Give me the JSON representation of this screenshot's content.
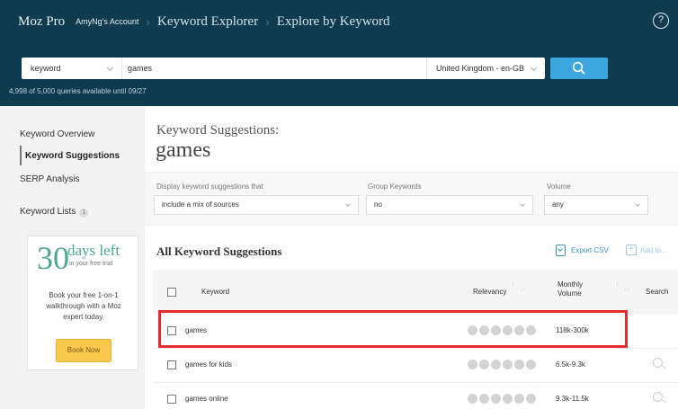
{
  "header": {
    "brand": "Moz Pro",
    "account": "AmyNg's Account",
    "breadcrumbs": [
      "Keyword Explorer",
      "Explore by Keyword"
    ],
    "help_glyph": "?"
  },
  "search": {
    "type_value": "keyword",
    "query_value": "games",
    "locale_value": "United Kingdom - en-GB",
    "quota_text": "4,998 of 5,000 queries available until 09/27"
  },
  "sidebar": {
    "items": [
      {
        "label": "Keyword Overview"
      },
      {
        "label": "Keyword Suggestions"
      },
      {
        "label": "SERP Analysis"
      },
      {
        "label": "Keyword Lists"
      }
    ],
    "lists_count": "1",
    "trial": {
      "days_number": "30",
      "days_label": "days left",
      "sub": "in your free trial",
      "text": "Book your free 1-on-1 walkthrough with a Moz expert today.",
      "button": "Book Now"
    }
  },
  "main": {
    "heading": "Keyword Suggestions:",
    "query": "games",
    "filters": {
      "display_label": "Display keyword suggestions that",
      "display_value": "include a mix of sources",
      "group_label": "Group Keywords",
      "group_value": "no",
      "volume_label": "Volume",
      "volume_value": "any"
    },
    "section_title": "All Keyword Suggestions",
    "export_label": "Export CSV",
    "addto_label": "Add to...",
    "table": {
      "headers": {
        "keyword": "Keyword",
        "relevancy": "Relevancy",
        "volume_line1": "Monthly",
        "volume_line2": "Volume",
        "search": "Search"
      },
      "rows": [
        {
          "keyword": "games",
          "volume": "118k-300k"
        },
        {
          "keyword": "games for kids",
          "volume": "6.5k-9.3k"
        },
        {
          "keyword": "games online",
          "volume": "9.3k-11.5k"
        }
      ]
    }
  },
  "colors": {
    "header_bg": "#0f3b4f",
    "search_button": "#3da6de",
    "trial_accent": "#4aa98f",
    "book_button": "#f8c94d",
    "highlight_border": "#e52b2b"
  }
}
